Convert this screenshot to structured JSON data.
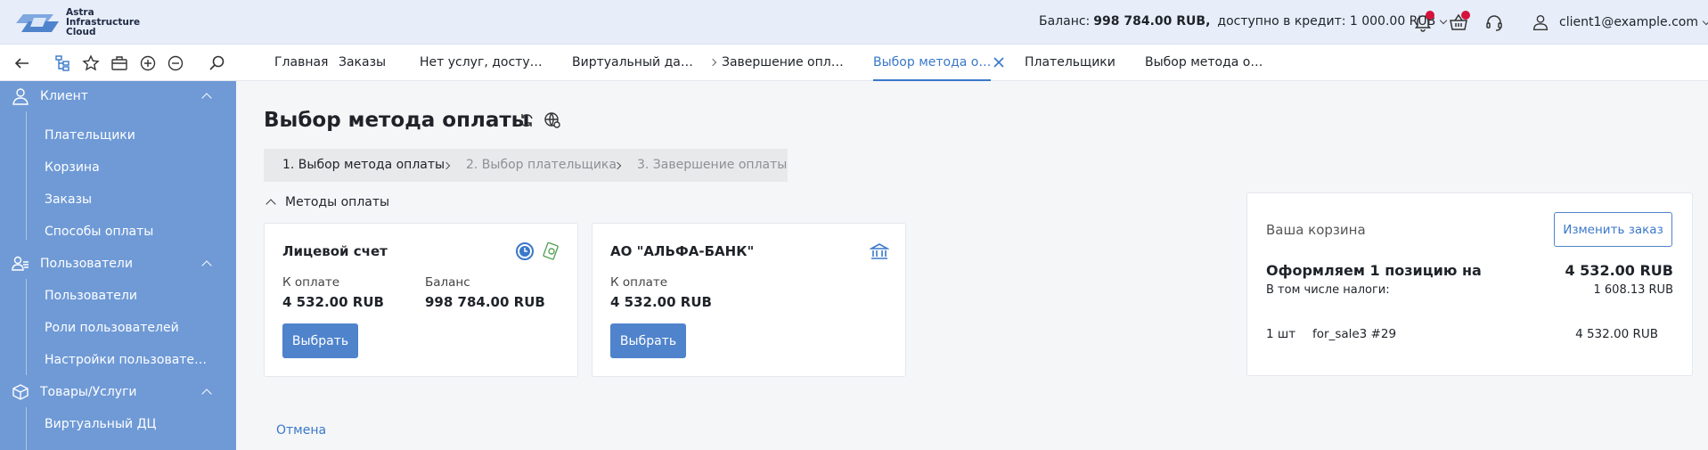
{
  "header": {
    "logo_lines": [
      "Astra",
      "Infrastructure",
      "Cloud"
    ],
    "balance_label": "Баланс:",
    "balance_value": "998 784.00 RUB,",
    "credit_text": "доступно в кредит: 1 000.00 RUB",
    "user_email": "client1@example.com"
  },
  "tabs": [
    {
      "label": "Главная"
    },
    {
      "label": "Заказы"
    },
    {
      "label": "Нет услуг, досту…"
    },
    {
      "label": "Виртуальный да…"
    },
    {
      "label": "Завершение опл…"
    },
    {
      "label": "Выбор метода о…"
    },
    {
      "label": "Плательщики"
    },
    {
      "label": "Выбор метода о…"
    }
  ],
  "sidebar": {
    "groups": [
      {
        "label": "Клиент",
        "items": [
          "Плательщики",
          "Корзина",
          "Заказы",
          "Способы оплаты"
        ]
      },
      {
        "label": "Пользователи",
        "items": [
          "Пользователи",
          "Роли пользователей",
          "Настройки пользовате…"
        ]
      },
      {
        "label": "Товары/Услуги",
        "items": [
          "Виртуальный ДЦ"
        ]
      }
    ]
  },
  "main": {
    "title": "Выбор метода оплаты",
    "steps": [
      "1. Выбор метода оплаты",
      "2. Выбор плательщика",
      "3. Завершение оплаты"
    ],
    "methods_label": "Методы оплаты",
    "cards": [
      {
        "title": "Лицевой счет",
        "pay_label": "К оплате",
        "pay_value": "4 532.00 RUB",
        "balance_label": "Баланс",
        "balance_value": "998 784.00 RUB",
        "button": "Выбрать"
      },
      {
        "title": "АО \"АЛЬФА-БАНК\"",
        "pay_label": "К оплате",
        "pay_value": "4 532.00 RUB",
        "button": "Выбрать"
      }
    ],
    "cancel": "Отмена"
  },
  "cart": {
    "title": "Ваша корзина",
    "edit_button": "Изменить заказ",
    "heading": "Оформляем 1 позицию на",
    "total": "4 532.00 RUB",
    "tax_label": "В том числе налоги:",
    "tax_value": "1 608.13 RUB",
    "items": [
      {
        "qty": "1 шт",
        "name": "for_sale3 #29",
        "price": "4 532.00 RUB"
      }
    ]
  },
  "colors": {
    "accent": "#3a78c9",
    "sidebar": "#6f9ad6",
    "button": "#4f83cc",
    "badge": "#d5123b"
  }
}
